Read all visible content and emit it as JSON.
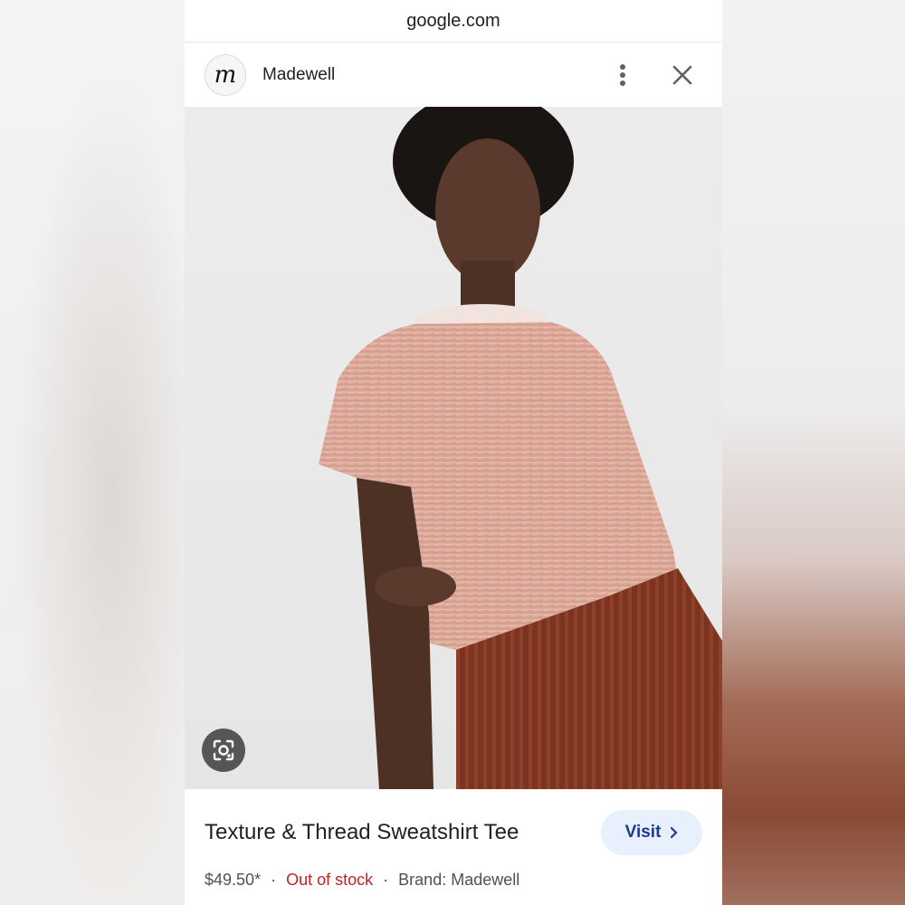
{
  "browser": {
    "url": "google.com"
  },
  "header": {
    "logo_letter": "m",
    "brand": "Madewell"
  },
  "product": {
    "title": "Texture & Thread Sweatshirt Tee",
    "price": "$49.50*",
    "stock": "Out of stock",
    "brand_text": "Brand: Madewell",
    "separator": "·"
  },
  "actions": {
    "visit_label": "Visit"
  },
  "icons": [
    "more-vert-icon",
    "close-icon",
    "lens-icon",
    "chevron-right-icon"
  ],
  "colors": {
    "visit_bg": "#e8f0fe",
    "visit_text": "#1a3b8f",
    "out_of_stock": "#c5221f"
  }
}
